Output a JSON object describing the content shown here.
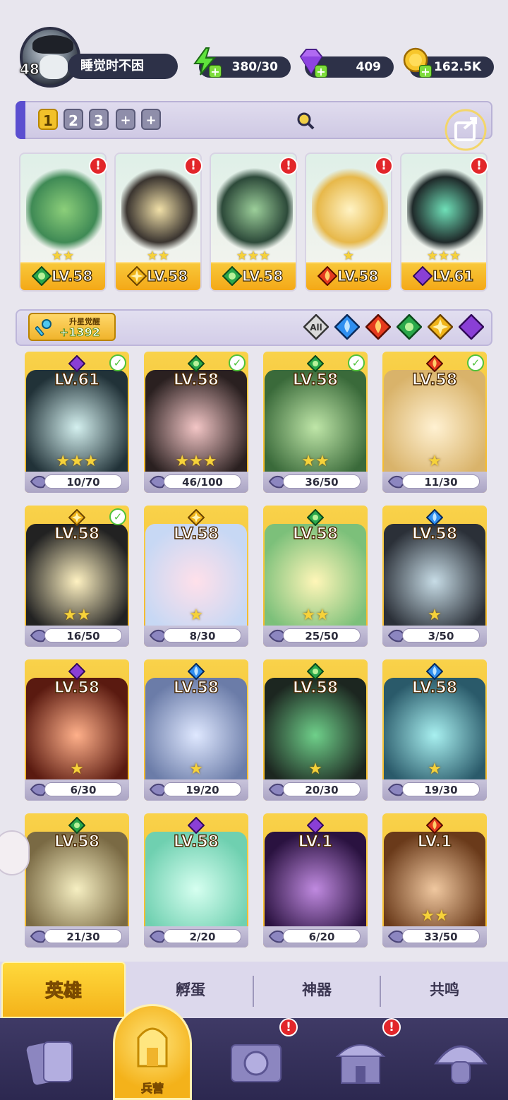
{
  "player": {
    "level": "48",
    "name": "睡觉时不困"
  },
  "resources": {
    "energy": "380/30",
    "gems": "409",
    "gold": "162.5K"
  },
  "team_tabs": [
    "1",
    "2",
    "3",
    "+",
    "+"
  ],
  "team": [
    {
      "level": "LV.58",
      "element": "nature",
      "stars": "★★"
    },
    {
      "level": "LV.58",
      "element": "light",
      "stars": "★★"
    },
    {
      "level": "LV.58",
      "element": "nature",
      "stars": "★★★"
    },
    {
      "level": "LV.58",
      "element": "fire",
      "stars": "★"
    },
    {
      "level": "LV.61",
      "element": "dark",
      "stars": "★★★"
    }
  ],
  "awaken": {
    "label": "升星觉醒",
    "value": "+1392"
  },
  "filters": [
    "All",
    "water",
    "fire",
    "nature",
    "light",
    "dark"
  ],
  "filter_all_label": "All",
  "colors": {
    "water": "#2f8ff0",
    "fire": "#e53a1e",
    "nature": "#2aa84a",
    "light": "#f0b41a",
    "dark": "#8a3fd6"
  },
  "heroes": [
    {
      "level": "LV.61",
      "element": "dark",
      "progress": "10/70",
      "checked": true,
      "stars": "★★★"
    },
    {
      "level": "LV.58",
      "element": "nature",
      "progress": "46/100",
      "checked": true,
      "stars": "★★★"
    },
    {
      "level": "LV.58",
      "element": "nature",
      "progress": "36/50",
      "checked": true,
      "stars": "★★"
    },
    {
      "level": "LV.58",
      "element": "fire",
      "progress": "11/30",
      "checked": true,
      "stars": "★"
    },
    {
      "level": "LV.58",
      "element": "light",
      "progress": "16/50",
      "checked": true,
      "stars": "★★"
    },
    {
      "level": "LV.58",
      "element": "light",
      "progress": "8/30",
      "checked": false,
      "stars": "★"
    },
    {
      "level": "LV.58",
      "element": "nature",
      "progress": "25/50",
      "checked": false,
      "stars": "★★"
    },
    {
      "level": "LV.58",
      "element": "water",
      "progress": "3/50",
      "checked": false,
      "stars": "★"
    },
    {
      "level": "LV.58",
      "element": "dark",
      "progress": "6/30",
      "checked": false,
      "stars": "★"
    },
    {
      "level": "LV.58",
      "element": "water",
      "progress": "19/20",
      "checked": false,
      "stars": "★"
    },
    {
      "level": "LV.58",
      "element": "nature",
      "progress": "20/30",
      "checked": false,
      "stars": "★"
    },
    {
      "level": "LV.58",
      "element": "water",
      "progress": "19/30",
      "checked": false,
      "stars": "★"
    },
    {
      "level": "LV.58",
      "element": "nature",
      "progress": "21/30",
      "checked": false,
      "stars": ""
    },
    {
      "level": "LV.58",
      "element": "dark",
      "progress": "2/20",
      "checked": false,
      "stars": ""
    },
    {
      "level": "LV.1",
      "element": "dark",
      "progress": "6/20",
      "checked": false,
      "stars": ""
    },
    {
      "level": "LV.1",
      "element": "fire",
      "progress": "33/50",
      "checked": false,
      "stars": "★★"
    }
  ],
  "sub_tabs": [
    "英雄",
    "孵蛋",
    "神器",
    "共鸣"
  ],
  "nav": {
    "active_label": "兵营"
  },
  "alert_mark": "!",
  "check_mark": "✓"
}
